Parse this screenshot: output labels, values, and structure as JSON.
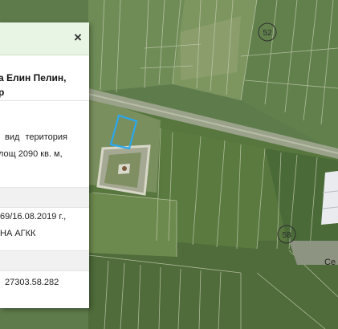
{
  "map": {
    "parcel_labels": [
      "52",
      "58"
    ],
    "place_label": "Се",
    "highlight_color": "#29a8f0"
  },
  "popup": {
    "close_label": "×",
    "title_line1": "а Елин Пелин,",
    "title_line2": "р",
    "desc_line1": "вид територия",
    "desc_line2": "лощ 2090 кв. м,",
    "order_line1": "69/16.08.2019 г.,",
    "order_line2": "НА АГКК",
    "identifier": "27303.58.282"
  }
}
